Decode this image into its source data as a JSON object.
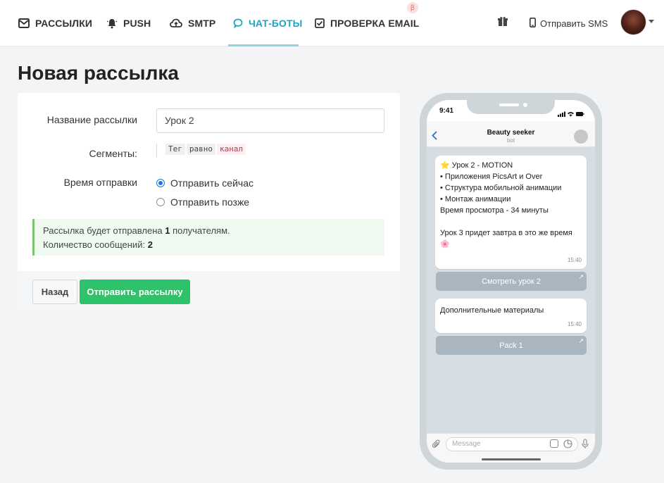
{
  "nav": {
    "items": [
      {
        "label": "РАССЫЛКИ",
        "icon": "envelope-icon"
      },
      {
        "label": "PUSH",
        "icon": "bell-icon"
      },
      {
        "label": "SMTP",
        "icon": "cloud-icon"
      },
      {
        "label": "ЧАТ-БОТЫ",
        "icon": "chat-icon",
        "active": true
      },
      {
        "label": "ПРОВЕРКА EMAIL",
        "icon": "checkbox-icon"
      }
    ],
    "beta_badge": "β",
    "send_sms": "Отправить SMS",
    "accent_color": "#1aa7c4"
  },
  "page": {
    "title": "Новая рассылка"
  },
  "form": {
    "name_label": "Название рассылки",
    "name_value": "Урок 2",
    "segments_label": "Сегменты:",
    "segment_chips": [
      "Тег",
      "равно",
      "канал"
    ],
    "send_time_label": "Время отправки",
    "options": [
      "Отправить сейчас",
      "Отправить позже"
    ],
    "selected_option": "Отправить сейчас",
    "notice": {
      "line1_prefix": "Рассылка будет отправлена ",
      "recipients": "1",
      "line1_suffix": " получателям.",
      "line2_prefix": "Количество сообщений: ",
      "messages": "2"
    },
    "back_button": "Назад",
    "send_button": "Отправить рассылку",
    "send_button_color": "#2ec36a"
  },
  "phone": {
    "status_time": "9:41",
    "chat_title": "Beauty seeker",
    "chat_subtitle": "bot",
    "messages": [
      {
        "lines": [
          "⭐ Урок 2 - MOTION",
          "• Приложения PicsArt и Over",
          "• Структура мобильной анимации",
          "• Монтаж анимации",
          "Время просмотра - 34 минуты",
          "",
          "Урок 3 придет завтра в это же время",
          "🌸"
        ],
        "time": "15:40",
        "button": "Смотреть урок 2"
      },
      {
        "lines": [
          "Дополнительные материалы"
        ],
        "time": "15:40",
        "button": "Pack 1"
      }
    ],
    "input_placeholder": "Message"
  }
}
